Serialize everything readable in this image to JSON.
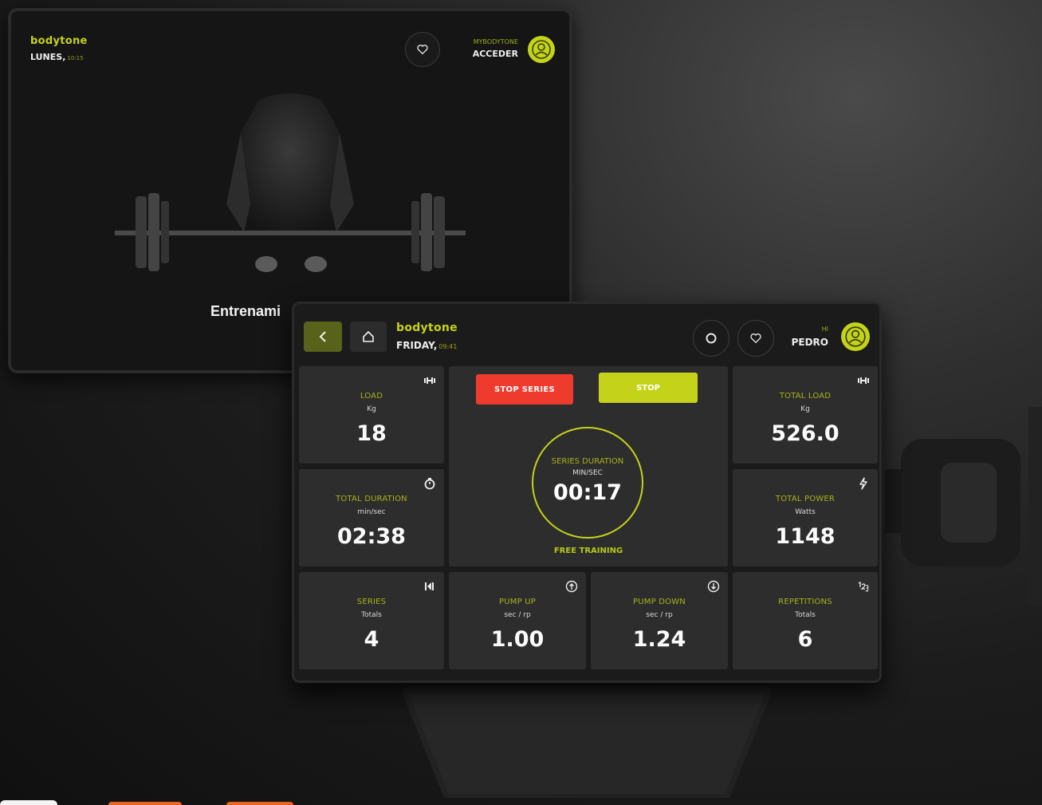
{
  "back_screen": {
    "brand": "bodytone",
    "day": "LUNES,",
    "time": "10:15",
    "account_small": "MYBODYTONE",
    "account_action": "ACCEDER",
    "title": "Entrenami"
  },
  "front_screen": {
    "brand": "bodytone",
    "day": "FRIDAY,",
    "time": "09:41",
    "greeting": "HI",
    "user_name": "PEDRO",
    "buttons": {
      "stop_series": "STOP SERIES",
      "stop": "STOP"
    },
    "session": {
      "label": "SERIES DURATION",
      "unit": "MIN/SEC",
      "value": "00:17",
      "mode": "FREE TRAINING"
    },
    "tiles": {
      "load": {
        "label": "LOAD",
        "unit": "Kg",
        "value": "18",
        "icon": "dumbbell-icon"
      },
      "total_load": {
        "label": "TOTAL LOAD",
        "unit": "Kg",
        "value": "526.0",
        "icon": "dumbbell-icon"
      },
      "total_duration": {
        "label": "TOTAL DURATION",
        "unit": "min/sec",
        "value": "02:38",
        "icon": "timer-icon"
      },
      "total_power": {
        "label": "TOTAL POWER",
        "unit": "Watts",
        "value": "1148",
        "icon": "lightning-icon"
      },
      "series": {
        "label": "SERIES",
        "unit": "Totals",
        "value": "4",
        "icon": "series-icon"
      },
      "pump_up": {
        "label": "PUMP UP",
        "unit": "sec / rp",
        "value": "1.00",
        "icon": "arrow-up-circle-icon"
      },
      "pump_down": {
        "label": "PUMP DOWN",
        "unit": "sec / rp",
        "value": "1.24",
        "icon": "arrow-down-circle-icon"
      },
      "repetitions": {
        "label": "REPETITIONS",
        "unit": "Totals",
        "value": "6",
        "icon": "count-icon"
      }
    }
  },
  "colors": {
    "accent": "#c4d31a",
    "danger": "#ee3b2d",
    "tile": "#2d2d2d",
    "screen": "#1b1b1b"
  }
}
